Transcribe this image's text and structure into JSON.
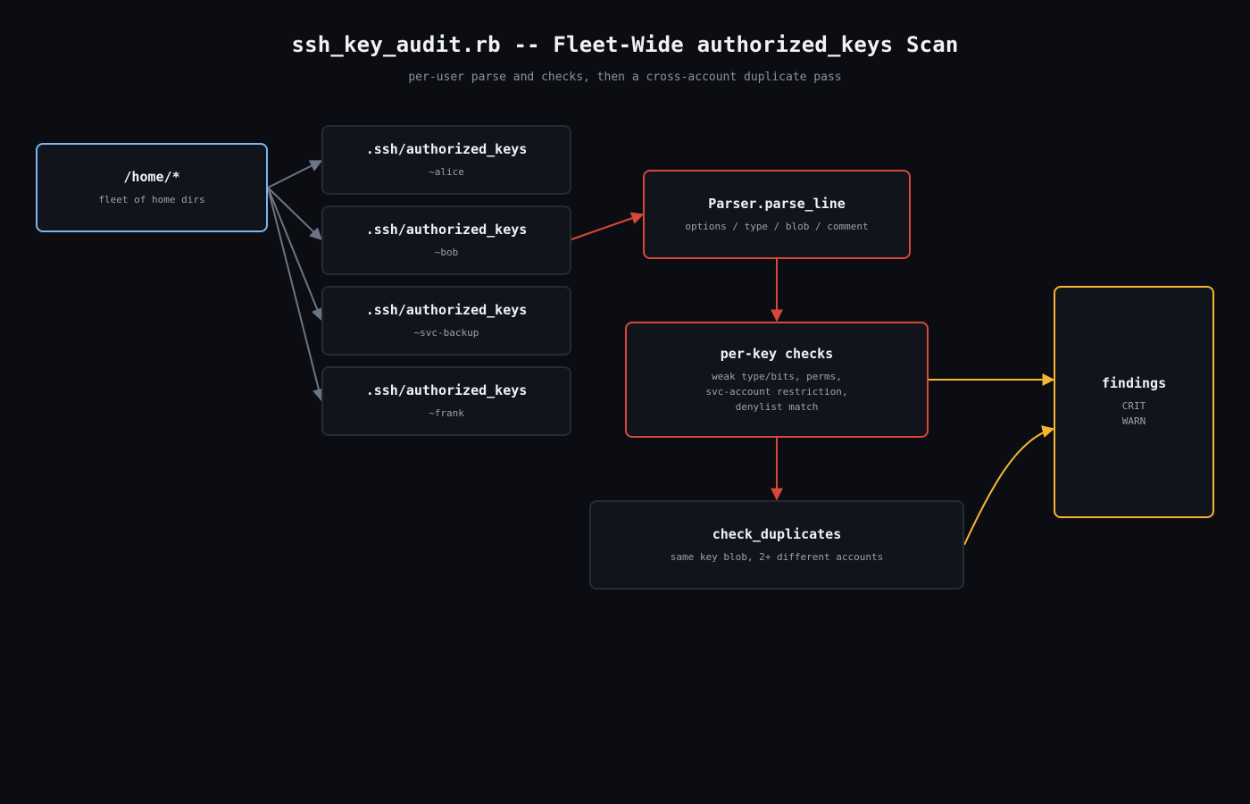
{
  "header": {
    "title": "ssh_key_audit.rb -- Fleet-Wide authorized_keys Scan",
    "subtitle": "per-user parse and checks, then a cross-account duplicate pass"
  },
  "nodes": {
    "home": {
      "label": "/home/*",
      "detail": "fleet of home dirs"
    },
    "keyfiles": [
      {
        "label": ".ssh/authorized_keys",
        "detail": "~alice"
      },
      {
        "label": ".ssh/authorized_keys",
        "detail": "~bob"
      },
      {
        "label": ".ssh/authorized_keys",
        "detail": "~svc-backup"
      },
      {
        "label": ".ssh/authorized_keys",
        "detail": "~frank"
      }
    ],
    "parser": {
      "label": "Parser.parse_line",
      "detail": "options / type / blob / comment"
    },
    "checks": {
      "label": "per-key checks",
      "detail_lines": [
        "weak type/bits, perms,",
        "svc-account restriction,",
        "denylist match"
      ]
    },
    "duplicates": {
      "label": "check_duplicates",
      "detail": "same key blob, 2+ different accounts"
    },
    "findings": {
      "label": "findings",
      "detail_lines": [
        "CRIT",
        "WARN"
      ]
    }
  },
  "colors": {
    "background": "#0b0d13",
    "node_fill": "#11141b",
    "source_border": "#7cb6ee",
    "neutral_border": "#262b33",
    "pipeline_red": "#d9473b",
    "findings_yellow": "#f2b632",
    "fanout_edge": "#6b7585"
  }
}
